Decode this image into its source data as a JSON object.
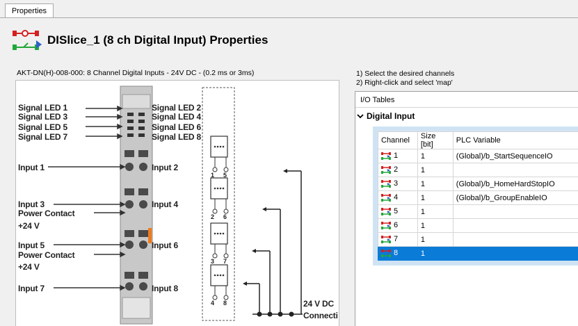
{
  "tab": {
    "label": "Properties"
  },
  "header": {
    "title": "DISlice_1 (8 ch Digital Input) Properties"
  },
  "module": {
    "description": "AKT-DN(H)-008-000: 8 Channel Digital Inputs - 24V DC - (0.2 ms or 3ms)"
  },
  "diagram": {
    "labels": {
      "led1": "Signal LED 1",
      "led3": "Signal LED 3",
      "led5": "Signal LED 5",
      "led7": "Signal LED 7",
      "led2": "Signal LED 2",
      "led4": "Signal LED 4",
      "led6": "Signal LED 6",
      "led8": "Signal LED 8",
      "in1": "Input 1",
      "in2": "Input 2",
      "in3": "Input 3",
      "pc1": "Power Contact",
      "v1": "+24 V",
      "in4": "Input 4",
      "in5": "Input 5",
      "pc2": "Power Contact",
      "v2": "+24 V",
      "in6": "Input 6",
      "in7": "Input 7",
      "in8": "Input 8",
      "dc": "24 V DC",
      "conn": "Connecti",
      "t1": "1",
      "t5": "5",
      "t2": "2",
      "t6": "6",
      "t3": "3",
      "t7": "7",
      "t4": "4",
      "t8": "8"
    }
  },
  "instructions": {
    "line1": "1) Select the desired channels",
    "line2": "2) Right-click and select 'map'"
  },
  "io": {
    "title": "I/O Tables",
    "group": "Digital Input",
    "columns": {
      "channel": "Channel",
      "size": "Size [bit]",
      "plc": "PLC Variable"
    },
    "rows": [
      {
        "channel": "1",
        "size": "1",
        "plc": "(Global)/b_StartSequenceIO"
      },
      {
        "channel": "2",
        "size": "1",
        "plc": ""
      },
      {
        "channel": "3",
        "size": "1",
        "plc": "(Global)/b_HomeHardStopIO"
      },
      {
        "channel": "4",
        "size": "1",
        "plc": "(Global)/b_GroupEnableIO"
      },
      {
        "channel": "5",
        "size": "1",
        "plc": ""
      },
      {
        "channel": "6",
        "size": "1",
        "plc": ""
      },
      {
        "channel": "7",
        "size": "1",
        "plc": ""
      },
      {
        "channel": "8",
        "size": "1",
        "plc": ""
      }
    ],
    "selected_row": "8"
  }
}
